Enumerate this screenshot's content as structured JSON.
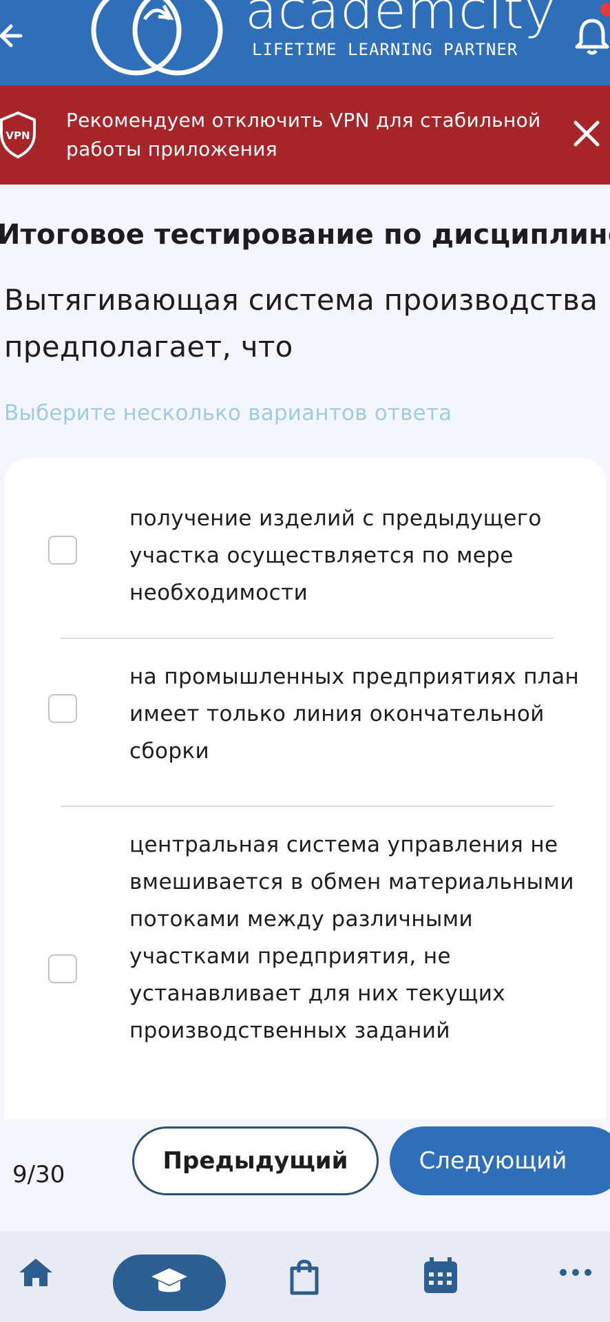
{
  "header": {
    "logo_text": "academcity",
    "tagline": "LIFETIME LEARNING PARTNER"
  },
  "banner": {
    "badge": "VPN",
    "message": "Рекомендуем отключить VPN для стабильной работы приложения"
  },
  "test": {
    "title": "Итоговое тестирование по дисциплине",
    "question": "Вытягивающая система производства предполагает, что",
    "hint": "Выберите несколько вариантов ответа",
    "options": [
      {
        "text": "получение изделий с предыдущего участка осуществляется по мере необходимости",
        "checked": false
      },
      {
        "text": "на промышленных предприятиях план имеет только линия окончательной сборки",
        "checked": false
      },
      {
        "text": "центральная система управления не вмешивается в обмен материальными потоками между различными участками предприятия, не устанавливает для них текущих производственных заданий",
        "checked": false
      }
    ]
  },
  "controls": {
    "counter": "9/30",
    "prev_label": "Предыдущий",
    "next_label": "Следующий"
  },
  "nav": {
    "items": [
      "home-icon",
      "graduation-cap-icon",
      "shopping-bag-icon",
      "calendar-icon",
      "more-icon"
    ],
    "active": "graduation-cap-icon"
  },
  "colors": {
    "header": "#2f6fba",
    "banner": "#a72428",
    "hint": "#9fcbe3",
    "nav_active": "#2c5e91"
  }
}
